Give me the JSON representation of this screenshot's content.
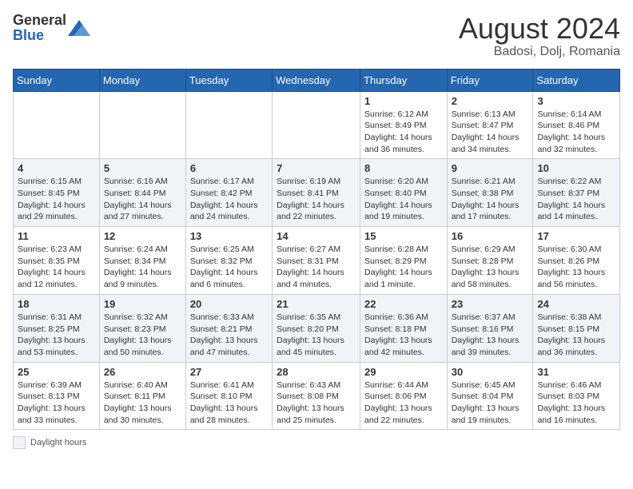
{
  "header": {
    "logo": {
      "general": "General",
      "blue": "Blue"
    },
    "month": "August 2024",
    "location": "Badosi, Dolj, Romania"
  },
  "weekdays": [
    "Sunday",
    "Monday",
    "Tuesday",
    "Wednesday",
    "Thursday",
    "Friday",
    "Saturday"
  ],
  "weeks": [
    [
      {
        "day": "",
        "info": ""
      },
      {
        "day": "",
        "info": ""
      },
      {
        "day": "",
        "info": ""
      },
      {
        "day": "",
        "info": ""
      },
      {
        "day": "1",
        "info": "Sunrise: 6:12 AM\nSunset: 8:49 PM\nDaylight: 14 hours and 36 minutes."
      },
      {
        "day": "2",
        "info": "Sunrise: 6:13 AM\nSunset: 8:47 PM\nDaylight: 14 hours and 34 minutes."
      },
      {
        "day": "3",
        "info": "Sunrise: 6:14 AM\nSunset: 8:46 PM\nDaylight: 14 hours and 32 minutes."
      }
    ],
    [
      {
        "day": "4",
        "info": "Sunrise: 6:15 AM\nSunset: 8:45 PM\nDaylight: 14 hours and 29 minutes."
      },
      {
        "day": "5",
        "info": "Sunrise: 6:16 AM\nSunset: 8:44 PM\nDaylight: 14 hours and 27 minutes."
      },
      {
        "day": "6",
        "info": "Sunrise: 6:17 AM\nSunset: 8:42 PM\nDaylight: 14 hours and 24 minutes."
      },
      {
        "day": "7",
        "info": "Sunrise: 6:19 AM\nSunset: 8:41 PM\nDaylight: 14 hours and 22 minutes."
      },
      {
        "day": "8",
        "info": "Sunrise: 6:20 AM\nSunset: 8:40 PM\nDaylight: 14 hours and 19 minutes."
      },
      {
        "day": "9",
        "info": "Sunrise: 6:21 AM\nSunset: 8:38 PM\nDaylight: 14 hours and 17 minutes."
      },
      {
        "day": "10",
        "info": "Sunrise: 6:22 AM\nSunset: 8:37 PM\nDaylight: 14 hours and 14 minutes."
      }
    ],
    [
      {
        "day": "11",
        "info": "Sunrise: 6:23 AM\nSunset: 8:35 PM\nDaylight: 14 hours and 12 minutes."
      },
      {
        "day": "12",
        "info": "Sunrise: 6:24 AM\nSunset: 8:34 PM\nDaylight: 14 hours and 9 minutes."
      },
      {
        "day": "13",
        "info": "Sunrise: 6:25 AM\nSunset: 8:32 PM\nDaylight: 14 hours and 6 minutes."
      },
      {
        "day": "14",
        "info": "Sunrise: 6:27 AM\nSunset: 8:31 PM\nDaylight: 14 hours and 4 minutes."
      },
      {
        "day": "15",
        "info": "Sunrise: 6:28 AM\nSunset: 8:29 PM\nDaylight: 14 hours and 1 minute."
      },
      {
        "day": "16",
        "info": "Sunrise: 6:29 AM\nSunset: 8:28 PM\nDaylight: 13 hours and 58 minutes."
      },
      {
        "day": "17",
        "info": "Sunrise: 6:30 AM\nSunset: 8:26 PM\nDaylight: 13 hours and 56 minutes."
      }
    ],
    [
      {
        "day": "18",
        "info": "Sunrise: 6:31 AM\nSunset: 8:25 PM\nDaylight: 13 hours and 53 minutes."
      },
      {
        "day": "19",
        "info": "Sunrise: 6:32 AM\nSunset: 8:23 PM\nDaylight: 13 hours and 50 minutes."
      },
      {
        "day": "20",
        "info": "Sunrise: 6:33 AM\nSunset: 8:21 PM\nDaylight: 13 hours and 47 minutes."
      },
      {
        "day": "21",
        "info": "Sunrise: 6:35 AM\nSunset: 8:20 PM\nDaylight: 13 hours and 45 minutes."
      },
      {
        "day": "22",
        "info": "Sunrise: 6:36 AM\nSunset: 8:18 PM\nDaylight: 13 hours and 42 minutes."
      },
      {
        "day": "23",
        "info": "Sunrise: 6:37 AM\nSunset: 8:16 PM\nDaylight: 13 hours and 39 minutes."
      },
      {
        "day": "24",
        "info": "Sunrise: 6:38 AM\nSunset: 8:15 PM\nDaylight: 13 hours and 36 minutes."
      }
    ],
    [
      {
        "day": "25",
        "info": "Sunrise: 6:39 AM\nSunset: 8:13 PM\nDaylight: 13 hours and 33 minutes."
      },
      {
        "day": "26",
        "info": "Sunrise: 6:40 AM\nSunset: 8:11 PM\nDaylight: 13 hours and 30 minutes."
      },
      {
        "day": "27",
        "info": "Sunrise: 6:41 AM\nSunset: 8:10 PM\nDaylight: 13 hours and 28 minutes."
      },
      {
        "day": "28",
        "info": "Sunrise: 6:43 AM\nSunset: 8:08 PM\nDaylight: 13 hours and 25 minutes."
      },
      {
        "day": "29",
        "info": "Sunrise: 6:44 AM\nSunset: 8:06 PM\nDaylight: 13 hours and 22 minutes."
      },
      {
        "day": "30",
        "info": "Sunrise: 6:45 AM\nSunset: 8:04 PM\nDaylight: 13 hours and 19 minutes."
      },
      {
        "day": "31",
        "info": "Sunrise: 6:46 AM\nSunset: 8:03 PM\nDaylight: 13 hours and 16 minutes."
      }
    ]
  ],
  "legend": {
    "label": "Daylight hours"
  }
}
